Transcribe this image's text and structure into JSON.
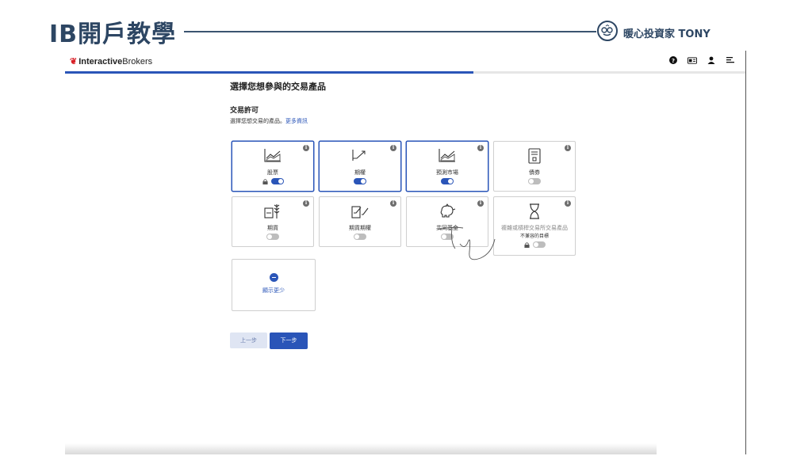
{
  "slide": {
    "title": "IB開戶教學",
    "brand": "暖心投資家 TONY"
  },
  "app": {
    "logo_prefix": "Interactive",
    "logo_suffix": "Brokers",
    "icons": [
      "help-icon",
      "id-card-icon",
      "user-icon",
      "menu-icon"
    ],
    "progress_percent": 60,
    "accent_color": "#2a55b8"
  },
  "page": {
    "title": "選擇您想參與的交易產品",
    "section_title": "交易許可",
    "section_desc": "選擇您想交易的產品。",
    "more_info": "更多資訊"
  },
  "products": [
    {
      "label": "股票",
      "on": true,
      "locked": true,
      "selected": true,
      "icon": "stock-chart-icon"
    },
    {
      "label": "期權",
      "on": true,
      "locked": false,
      "selected": true,
      "icon": "options-icon"
    },
    {
      "label": "預測市場",
      "on": true,
      "locked": false,
      "selected": true,
      "icon": "prediction-chart-icon"
    },
    {
      "label": "債券",
      "on": false,
      "locked": false,
      "selected": false,
      "icon": "bond-document-icon"
    },
    {
      "label": "期貨",
      "on": false,
      "locked": false,
      "selected": false,
      "icon": "futures-wheat-icon"
    },
    {
      "label": "期貨期權",
      "on": false,
      "locked": false,
      "selected": false,
      "icon": "futures-options-icon"
    },
    {
      "label": "共同基金",
      "on": false,
      "locked": false,
      "selected": false,
      "icon": "piggy-bank-icon"
    },
    {
      "label": "複雜或槓桿交易所交易產品",
      "sublabel": "不兼容的目標",
      "on": false,
      "locked": true,
      "selected": false,
      "disabled": true,
      "icon": "hourglass-icon"
    }
  ],
  "show_less": "顯示更少",
  "buttons": {
    "prev": "上一步",
    "next": "下一步"
  }
}
